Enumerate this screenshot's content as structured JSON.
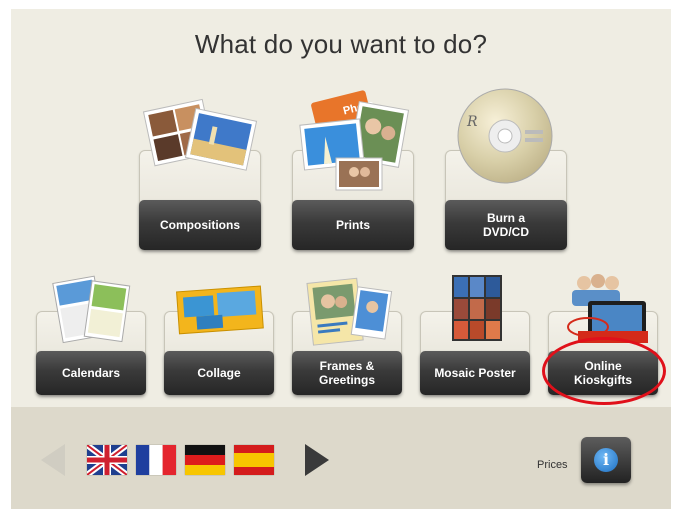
{
  "page": {
    "title": "What do you want to do?"
  },
  "tiles_top": [
    {
      "label": "Compositions"
    },
    {
      "label": "Prints"
    },
    {
      "label": "Burn a\nDVD/CD"
    }
  ],
  "tiles_bottom": [
    {
      "label": "Calendars"
    },
    {
      "label": "Collage"
    },
    {
      "label": "Frames &\nGreetings"
    },
    {
      "label": "Mosaic Poster"
    },
    {
      "label": "Online\nKioskgifts"
    }
  ],
  "footer": {
    "prices_label": "Prices",
    "info_icon_text": "i",
    "languages": [
      "English",
      "French",
      "German",
      "Spanish"
    ]
  },
  "colors": {
    "background": "#efede3",
    "footer_background": "#ddd9cb",
    "button": "#333333",
    "highlight": "#e0101a",
    "info": "#2a7fd4"
  }
}
